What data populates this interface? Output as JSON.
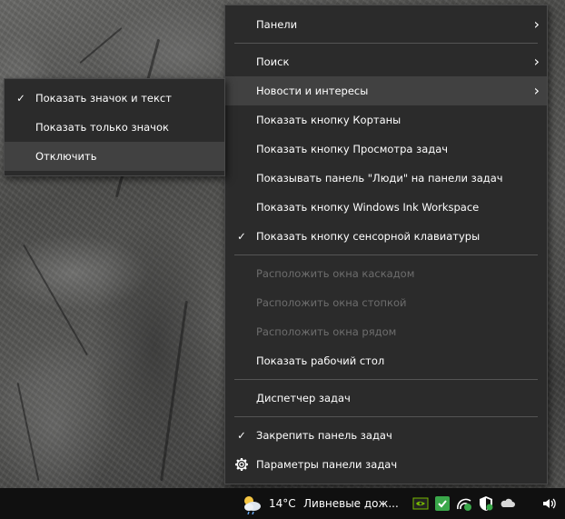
{
  "main_menu": {
    "items": [
      {
        "label": "Панели",
        "has_submenu": true
      },
      {
        "label": "Поиск",
        "has_submenu": true
      },
      {
        "label": "Новости и интересы",
        "has_submenu": true,
        "highlighted": true
      },
      {
        "label": "Показать кнопку Кортаны"
      },
      {
        "label": "Показать кнопку Просмотра задач"
      },
      {
        "label": "Показывать панель \"Люди\" на панели задач"
      },
      {
        "label": "Показать кнопку Windows Ink Workspace"
      },
      {
        "label": "Показать кнопку сенсорной клавиатуры",
        "checked": true
      },
      {
        "label": "Расположить окна каскадом",
        "disabled": true
      },
      {
        "label": "Расположить окна стопкой",
        "disabled": true
      },
      {
        "label": "Расположить окна рядом",
        "disabled": true
      },
      {
        "label": "Показать рабочий стол"
      },
      {
        "label": "Диспетчер задач"
      },
      {
        "label": "Закрепить панель задач",
        "checked": true
      },
      {
        "label": "Параметры панели задач",
        "icon": "gear-icon"
      }
    ],
    "check_glyph": "✓",
    "chevron_glyph": "›"
  },
  "sub_menu": {
    "items": [
      {
        "label": "Показать значок и текст",
        "checked": true
      },
      {
        "label": "Показать только значок"
      },
      {
        "label": "Отключить",
        "highlighted": true
      }
    ]
  },
  "taskbar": {
    "weather_icon": "partly-cloudy-icon",
    "temperature": "14°C",
    "weather_text": "Ливневые дож...",
    "tray_icons": [
      "nvidia-icon",
      "security-shield-icon",
      "network-activity-icon",
      "windows-security-icon",
      "onedrive-cloud-icon",
      "volume-icon"
    ]
  },
  "colors": {
    "menu_bg": "#2b2b2b",
    "menu_hover": "#414141",
    "disabled_text": "#6d6d6d",
    "taskbar_bg": "#101010",
    "accent_green": "#3aa84a"
  }
}
